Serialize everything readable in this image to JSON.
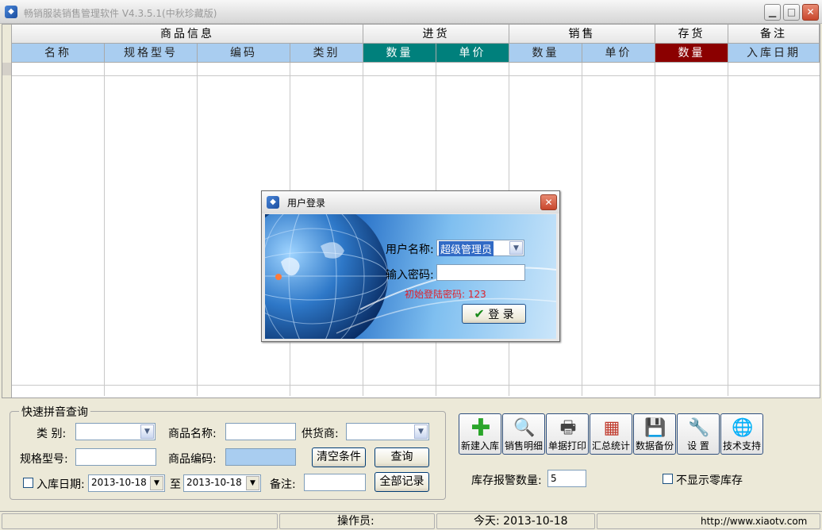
{
  "window": {
    "title": "畅销服装销售管理软件 V4.3.5.1(中秋珍藏版)",
    "min_glyph": "▁",
    "max_glyph": "□",
    "close_glyph": "✕"
  },
  "grid": {
    "groups": [
      "商品信息",
      "进货",
      "销售",
      "存货",
      "备注"
    ],
    "columns": [
      "名称",
      "规格型号",
      "编码",
      "类别",
      "数量",
      "单价",
      "数量",
      "单价",
      "数量",
      "入库日期"
    ]
  },
  "query": {
    "legend": "快速拼音查询",
    "category_label": "类    别:",
    "product_name_label": "商品名称:",
    "supplier_label": "供货商:",
    "spec_label": "规格型号:",
    "product_code_label": "商品编码:",
    "clear_button": "清空条件",
    "query_button": "查询",
    "date_label": "入库日期:",
    "date_from": "2013-10-18",
    "to_label": "至",
    "date_to": "2013-10-18",
    "remark_label": "备注:",
    "all_records_button": "全部记录"
  },
  "toolbar": {
    "items": [
      {
        "label": "新建入库",
        "icon": "plus-icon"
      },
      {
        "label": "销售明细",
        "icon": "magnifier-icon"
      },
      {
        "label": "单据打印",
        "icon": "printer-icon"
      },
      {
        "label": "汇总统计",
        "icon": "calendar-icon"
      },
      {
        "label": "数据备份",
        "icon": "floppy-icon"
      },
      {
        "label": "设  置",
        "icon": "wrench-icon"
      },
      {
        "label": "技术支持",
        "icon": "globe-icon"
      }
    ]
  },
  "stock": {
    "alarm_label": "库存报警数量:",
    "alarm_value": "5",
    "hide_zero_label": "不显示零库存"
  },
  "status": {
    "operator": "操作员:",
    "today": "今天: 2013-10-18",
    "website": "http://www.xiaotv.com"
  },
  "login": {
    "title": "用户登录",
    "username_label": "用户名称:",
    "username_value": "超级管理员",
    "password_label": "输入密码:",
    "password_value": "",
    "hint": "初始登陆密码: 123",
    "login_button": "登 录",
    "hint_color": "#e0202a"
  }
}
